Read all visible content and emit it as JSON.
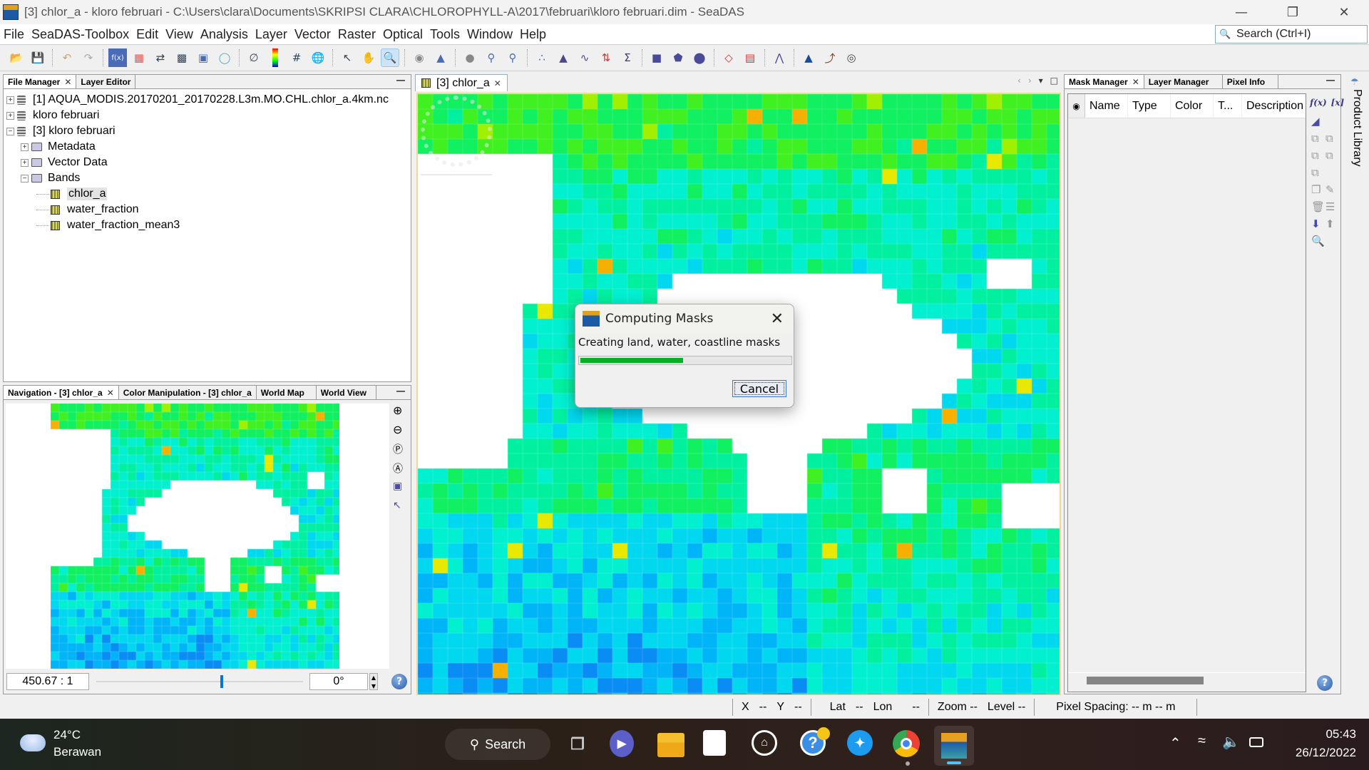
{
  "window": {
    "title": "[3] chlor_a - kloro februari - C:\\Users\\clara\\Documents\\SKRIPSI CLARA\\CHLOROPHYLL-A\\2017\\februari\\kloro februari.dim - SeaDAS",
    "controls": {
      "minimize": "—",
      "restore": "❐",
      "close": "✕"
    }
  },
  "menu": [
    "File",
    "SeaDAS-Toolbox",
    "Edit",
    "View",
    "Analysis",
    "Layer",
    "Vector",
    "Raster",
    "Optical",
    "Tools",
    "Window",
    "Help"
  ],
  "search": {
    "placeholder": "Search (Ctrl+I)"
  },
  "toolbar": {
    "icons": [
      "open-product",
      "save-product",
      "undo",
      "redo",
      "band-maths",
      "pixel-grid",
      "reprojection",
      "subset",
      "mosaic",
      "graticule-3d",
      "no-data",
      "color-legend",
      "grid",
      "world-globe",
      "select-tool",
      "pan-tool",
      "zoom-tool",
      "pin-tool",
      "pin-manager",
      "range-finder",
      "magic-wand",
      "gcp-tool",
      "scatter-plot",
      "histogram",
      "profile-plot",
      "statistics-plot",
      "statistics-sum",
      "rect-draw",
      "polygon-draw",
      "ellipse-draw",
      "graph-builder",
      "batch-processing",
      "spectrum",
      "land-mask",
      "coastline",
      "contour"
    ],
    "selected": "zoom-tool"
  },
  "file_manager": {
    "tabs": [
      {
        "label": "File Manager",
        "closable": true,
        "active": true
      },
      {
        "label": "Layer Editor",
        "active": false
      }
    ],
    "tree": [
      {
        "label": "[1] AQUA_MODIS.20170201_20170228.L3m.MO.CHL.chlor_a.4km.nc",
        "level": 0,
        "type": "product",
        "expanded": false
      },
      {
        "label": "kloro februari",
        "level": 0,
        "type": "product",
        "expanded": false
      },
      {
        "label": "[3] kloro februari",
        "level": 0,
        "type": "product",
        "expanded": true
      },
      {
        "label": "Metadata",
        "level": 1,
        "type": "folder",
        "expanded": false
      },
      {
        "label": "Vector Data",
        "level": 1,
        "type": "folder",
        "expanded": false
      },
      {
        "label": "Bands",
        "level": 1,
        "type": "folder",
        "expanded": true
      },
      {
        "label": "chlor_a",
        "level": 2,
        "type": "band",
        "selected": true
      },
      {
        "label": "water_fraction",
        "level": 2,
        "type": "band"
      },
      {
        "label": "water_fraction_mean3",
        "level": 2,
        "type": "band"
      }
    ]
  },
  "navigation": {
    "tabs": [
      {
        "label": "Navigation - [3] chlor_a",
        "closable": true,
        "active": true
      },
      {
        "label": "Color Manipulation - [3] chlor_a"
      },
      {
        "label": "World Map"
      },
      {
        "label": "World View"
      }
    ],
    "scale": "450.67 : 1",
    "rotation": "0°",
    "slider_fraction": 0.6,
    "side_tools": [
      "zoom-in",
      "zoom-out",
      "zoom-pixel",
      "zoom-all",
      "sync-views",
      "sync-cursor"
    ]
  },
  "image_view": {
    "tab": "[3] chlor_a",
    "nav_arrows": [
      "‹",
      "›",
      "▾",
      "□"
    ]
  },
  "dialog": {
    "title": "Computing Masks",
    "message": "Creating land, water, coastline masks",
    "progress_percent": 49,
    "cancel_label": "Cancel",
    "progress_color": "#06b025"
  },
  "mask_manager": {
    "tabs": [
      {
        "label": "Mask Manager",
        "closable": true,
        "active": true
      },
      {
        "label": "Layer Manager"
      },
      {
        "label": "Pixel Info"
      }
    ],
    "columns": [
      "Name",
      "Type",
      "Color",
      "T...",
      "Description"
    ],
    "fx_label": "f(x)",
    "var_label": "[x]",
    "side_rail_label": "Product Library"
  },
  "statusbar": {
    "x": "X",
    "x_val": "--",
    "y": "Y",
    "y_val": "--",
    "lat": "Lat",
    "lat_val": "--",
    "lon": "Lon",
    "lon_val": "--",
    "zoom": "Zoom --",
    "level": "Level --",
    "pixel_spacing": "Pixel Spacing: -- m -- m"
  },
  "taskbar": {
    "weather_temp": "24°C",
    "weather_desc": "Berawan",
    "search_label": "Search",
    "time": "05:43",
    "date": "26/12/2022",
    "apps": [
      "windows-start",
      "search",
      "task-view",
      "zoom-meetings",
      "file-explorer",
      "microsoft-store",
      "app-shield",
      "help",
      "twitter",
      "chrome",
      "seadas"
    ]
  },
  "colors": {
    "accent": "#0078d7",
    "progress": "#06b025",
    "land": "#ffffff"
  }
}
